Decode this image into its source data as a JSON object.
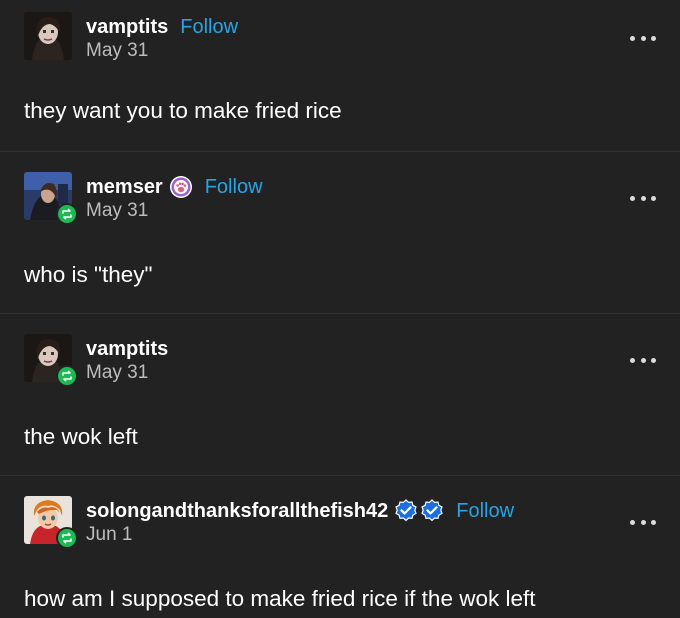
{
  "posts": [
    {
      "username": "vamptits",
      "follow_label": "Follow",
      "date": "May 31",
      "text": "they want you to make fried rice",
      "reblog": false
    },
    {
      "username": "memser",
      "follow_label": "Follow",
      "date": "May 31",
      "text": "who is \"they\"",
      "reblog": true,
      "badge_icon": "paw-badge-icon"
    },
    {
      "username": "vamptits",
      "date": "May 31",
      "text": "the wok left",
      "reblog": true
    },
    {
      "username": "solongandthanksforallthefish42",
      "follow_label": "Follow",
      "date": "Jun 1",
      "text": "how am I supposed to make fried rice if the wok left",
      "reblog": true,
      "badge_icons": [
        "verified-badge-icon",
        "verified-badge-icon"
      ]
    }
  ],
  "colors": {
    "background": "#222222",
    "follow": "#29a3e6",
    "reblog_badge": "#1db954",
    "verified": "#1d6fe0",
    "paw_badge": "#a05ed6"
  }
}
